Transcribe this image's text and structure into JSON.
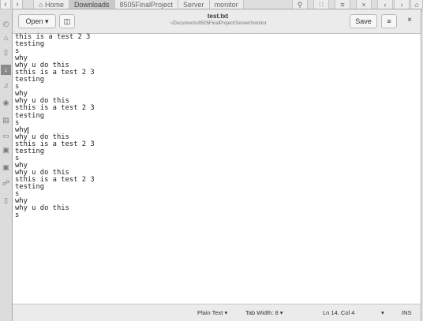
{
  "background": {
    "crumbs": [
      "Home",
      "Downloads",
      "8505FinalProject",
      "Server",
      "monitor"
    ],
    "active_crumb": 1
  },
  "gedit": {
    "open_label": "Open",
    "title": "test.txt",
    "subtitle": "~/Documents/8505FinalProject/Server/monitor",
    "save_label": "Save",
    "lines": [
      "this is a test 2 3",
      "testing",
      "s",
      "why",
      "why u do this",
      "sthis is a test 2 3",
      "testing",
      "s",
      "why",
      "why u do this",
      "sthis is a test 2 3",
      "testing",
      "s",
      "why",
      "why u do this",
      "sthis is a test 2 3",
      "testing",
      "s",
      "why",
      "why u do this",
      "sthis is a test 2 3",
      "testing",
      "s",
      "why",
      "why u do this",
      "s"
    ],
    "cursor_line": 13,
    "status": {
      "language": "Plain Text",
      "tab_width": "Tab Width: 8",
      "position": "Ln 14, Col 4",
      "mode": "INS"
    }
  }
}
